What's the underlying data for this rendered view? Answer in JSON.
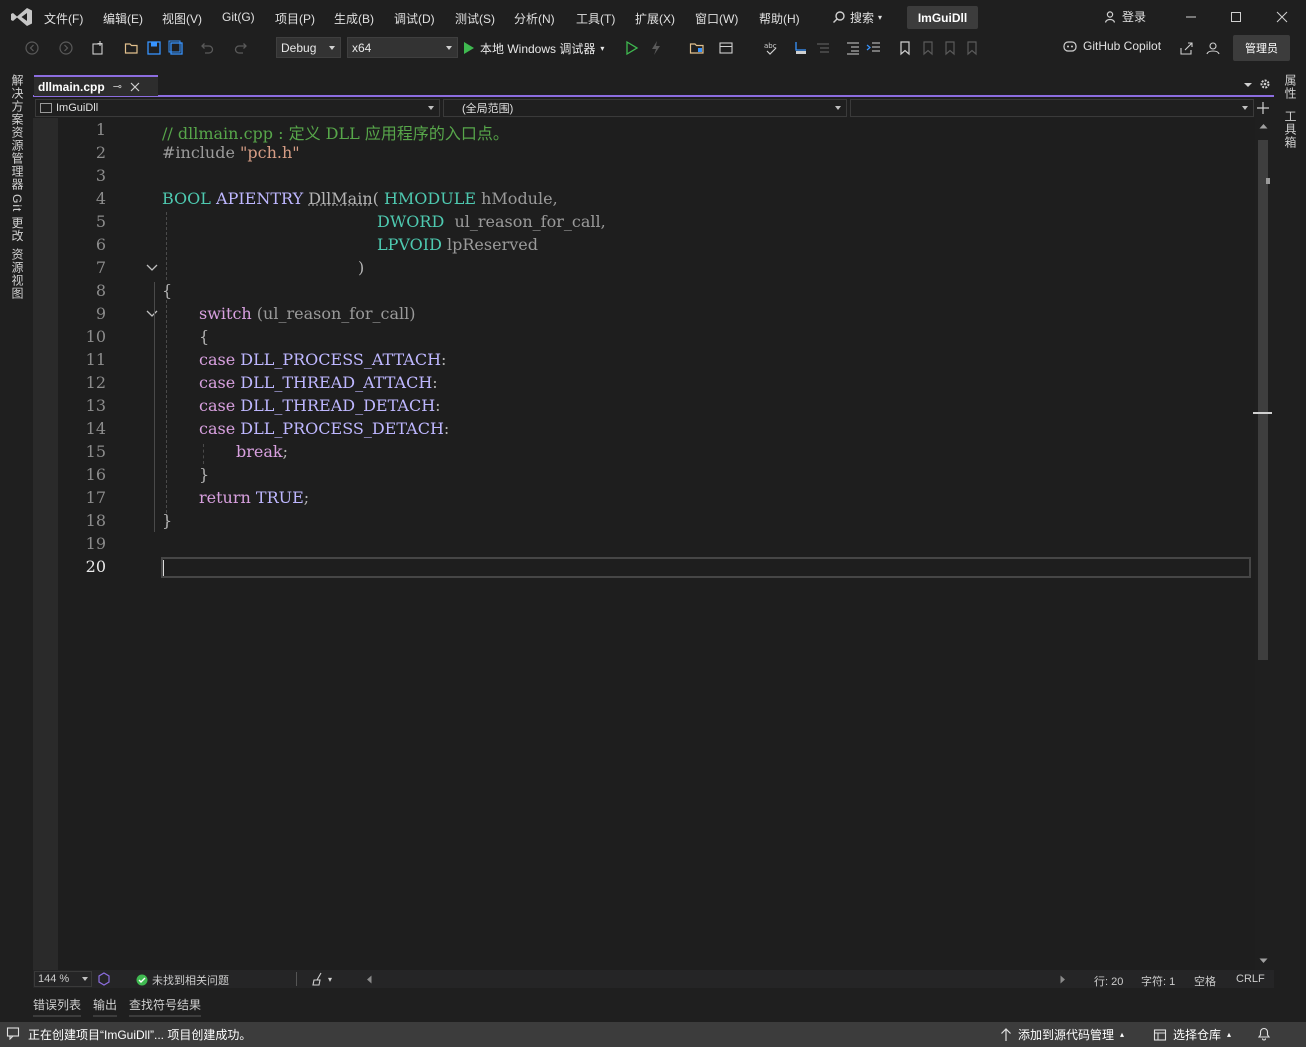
{
  "menu": {
    "items": [
      "文件(F)",
      "编辑(E)",
      "视图(V)",
      "Git(G)",
      "项目(P)",
      "生成(B)",
      "调试(D)",
      "测试(S)",
      "分析(N)",
      "工具(T)",
      "扩展(X)",
      "窗口(W)",
      "帮助(H)"
    ],
    "search_label": "搜索",
    "project_name": "ImGuiDll",
    "login_label": "登录"
  },
  "toolbar": {
    "config": "Debug",
    "platform": "x64",
    "run_label": "本地 Windows 调试器",
    "copilot_label": "GitHub Copilot",
    "admin_label": "管理员"
  },
  "left_rail": {
    "tabs": [
      "解决方案资源管理器",
      "Git 更改",
      "资源视图"
    ]
  },
  "right_rail": {
    "tabs": [
      "属性",
      "工具箱"
    ]
  },
  "document": {
    "tab_label": "dllmain.cpp",
    "nav_project": "ImGuiDll",
    "nav_scope": "(全局范围)"
  },
  "editor": {
    "line_numbers": [
      "1",
      "2",
      "3",
      "4",
      "5",
      "6",
      "7",
      "8",
      "9",
      "10",
      "11",
      "12",
      "13",
      "14",
      "15",
      "16",
      "17",
      "18",
      "19",
      "20"
    ],
    "active_line": "20",
    "code": {
      "l1": "// dllmain.cpp : 定义 DLL 应用程序的入口点。",
      "l2_pre": "#include ",
      "l2_str": "\"pch.h\"",
      "l4_type": "BOOL",
      "l4_macro": "APIENTRY",
      "l4_fn": "DllMain",
      "l4_open": "( ",
      "l4_ptype": "HMODULE",
      "l4_param": " hModule,",
      "l5_ptype": "DWORD",
      "l5_param": "  ul_reason_for_call,",
      "l6_ptype": "LPVOID",
      "l6_param": " lpReserved",
      "l7": ")",
      "l8": "{",
      "l9_kw": "switch",
      "l9_rest": " (ul_reason_for_call)",
      "l10": "{",
      "l11_kw": "case",
      "l11_m": "DLL_PROCESS_ATTACH",
      "l12_kw": "case",
      "l12_m": "DLL_THREAD_ATTACH",
      "l13_kw": "case",
      "l13_m": "DLL_THREAD_DETACH",
      "l14_kw": "case",
      "l14_m": "DLL_PROCESS_DETACH",
      "colon": ":",
      "l15_kw": "break",
      "l15_rest": ";",
      "l16": "}",
      "l17_kw": "return",
      "l17_m": "TRUE",
      "l17_rest": ";",
      "l18": "}"
    }
  },
  "editor_status": {
    "zoom": "144 %",
    "issues_label": "未找到相关问题",
    "line_label": "行: 20",
    "char_label": "字符: 1",
    "spacing_label": "空格",
    "eol_label": "CRLF"
  },
  "bottom_tabs": [
    "错误列表",
    "输出",
    "查找符号结果"
  ],
  "status": {
    "message": "正在创建项目“ImGuiDll”... 项目创建成功。",
    "source_control_label": "添加到源代码管理",
    "repo_label": "选择仓库"
  },
  "colors": {
    "accent": "#8c6ddf",
    "comment": "#57a64a",
    "keyword": "#d8a0df",
    "type": "#4ec9b0",
    "macro": "#beb7ff",
    "run_green": "#3fb950"
  }
}
